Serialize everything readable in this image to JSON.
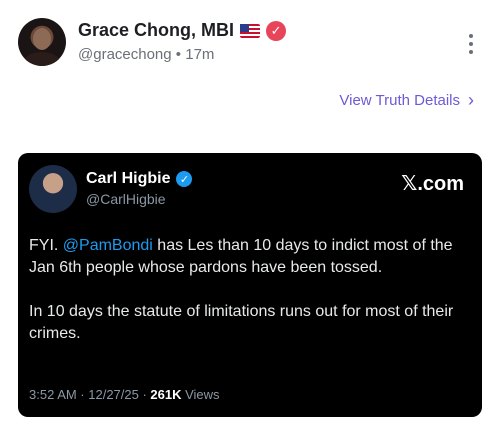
{
  "post": {
    "author_name": "Grace Chong, MBI",
    "handle": "@gracechong",
    "separator": "•",
    "time": "17m",
    "view_truth_label": "View Truth Details",
    "chevron": "›",
    "verified_glyph": "✓"
  },
  "embed": {
    "author_name": "Carl Higbie",
    "handle": "@CarlHigbie",
    "source": "𝕏.com",
    "verified_glyph": "✓",
    "text": {
      "p1_prefix": "FYI. ",
      "mention": "@PamBondi",
      "p1_suffix": " has Les than 10 days to indict most of the Jan 6th people whose pardons have been tossed.",
      "p2": "In 10 days the statute of limitations runs out for most of their crimes."
    },
    "time": "3:52 AM · 12/27/25 · ",
    "views_count": "261K",
    "views_label": " Views"
  },
  "colors": {
    "accent": "#6c5bd6",
    "verified_red": "#e8455a",
    "verified_blue": "#1d9bf0",
    "card_bg": "#000000"
  },
  "icons": {
    "menu": "more-vertical-icon",
    "flag": "us-flag-icon"
  }
}
